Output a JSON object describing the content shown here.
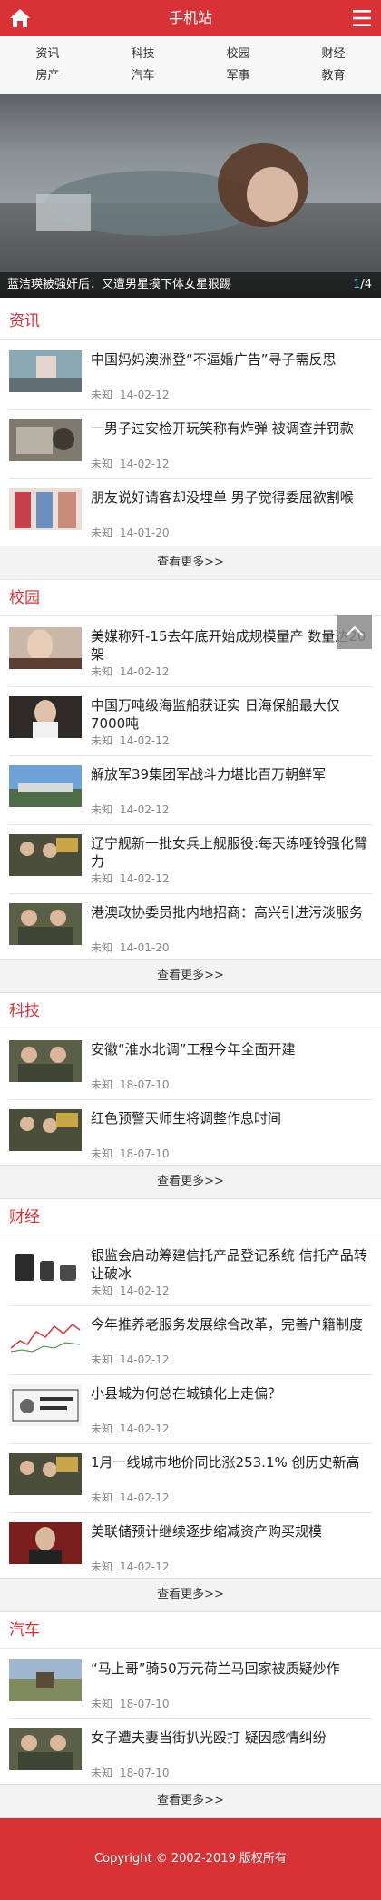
{
  "header": {
    "title": "手机站",
    "home_icon": "home-icon",
    "menu_icon": "menu-icon"
  },
  "nav": [
    "资讯",
    "科技",
    "校园",
    "财经",
    "房产",
    "汽车",
    "军事",
    "教育"
  ],
  "slider": {
    "caption": "蓝洁瑛被强奸后：又遭男星摸下体女星狠踢",
    "current": "1",
    "total": "/4"
  },
  "sections": [
    {
      "title": "资讯",
      "more": "查看更多>>",
      "items": [
        {
          "headline": "中国妈妈澳洲登“不逼婚广告”寻子需反思",
          "source": "未知",
          "date": "14-02-12"
        },
        {
          "headline": "一男子过安检开玩笑称有炸弹 被调查并罚款",
          "source": "未知",
          "date": "14-02-12"
        },
        {
          "headline": "朋友说好请客却没埋单 男子觉得委屈欲割喉",
          "source": "未知",
          "date": "14-01-20"
        }
      ]
    },
    {
      "title": "校园",
      "more": "查看更多>>",
      "items": [
        {
          "headline": "美媒称歼-15去年底开始成规模量产 数量达20架",
          "source": "未知",
          "date": "14-02-12"
        },
        {
          "headline": "中国万吨级海监船获证实 日海保船最大仅7000吨",
          "source": "未知",
          "date": "14-02-12"
        },
        {
          "headline": "解放军39集团军战斗力堪比百万朝鲜军",
          "source": "未知",
          "date": "14-02-12"
        },
        {
          "headline": "辽宁舰新一批女兵上舰服役:每天练哑铃强化臂力",
          "source": "未知",
          "date": "14-02-12"
        },
        {
          "headline": "港澳政协委员批内地招商：高兴引进污淡服务",
          "source": "未知",
          "date": "14-01-20"
        }
      ]
    },
    {
      "title": "科技",
      "more": "查看更多>>",
      "items": [
        {
          "headline": "安徽“淮水北调”工程今年全面开建",
          "source": "未知",
          "date": "18-07-10"
        },
        {
          "headline": "红色预警天师生将调整作息时间",
          "source": "未知",
          "date": "18-07-10"
        }
      ]
    },
    {
      "title": "财经",
      "more": "查看更多>>",
      "items": [
        {
          "headline": "银监会启动筹建信托产品登记系统 信托产品转让破冰",
          "source": "未知",
          "date": "14-02-12"
        },
        {
          "headline": "今年推养老服务发展综合改革，完善户籍制度",
          "source": "未知",
          "date": "14-02-12"
        },
        {
          "headline": "小县城为何总在城镇化上走偏？",
          "source": "未知",
          "date": "14-02-12"
        },
        {
          "headline": "1月一线城市地价同比涨253.1% 创历史新高",
          "source": "未知",
          "date": "14-02-12"
        },
        {
          "headline": "美联储预计继续逐步缩减资产购买规模",
          "source": "未知",
          "date": "14-02-12"
        }
      ]
    },
    {
      "title": "汽车",
      "more": "查看更多>>",
      "items": [
        {
          "headline": "“马上哥”骑50万元荷兰马回家被质疑炒作",
          "source": "未知",
          "date": "18-07-10"
        },
        {
          "headline": "女子遭夫妻当街扒光殴打 疑因感情纠纷",
          "source": "未知",
          "date": "18-07-10"
        }
      ]
    }
  ],
  "footer": {
    "copyright": "Copyright © 2002-2019 版权所有"
  },
  "colors": {
    "brand": "#d73336",
    "nav_bg": "#f7f7f7",
    "more_bg": "#f3f3f3"
  }
}
